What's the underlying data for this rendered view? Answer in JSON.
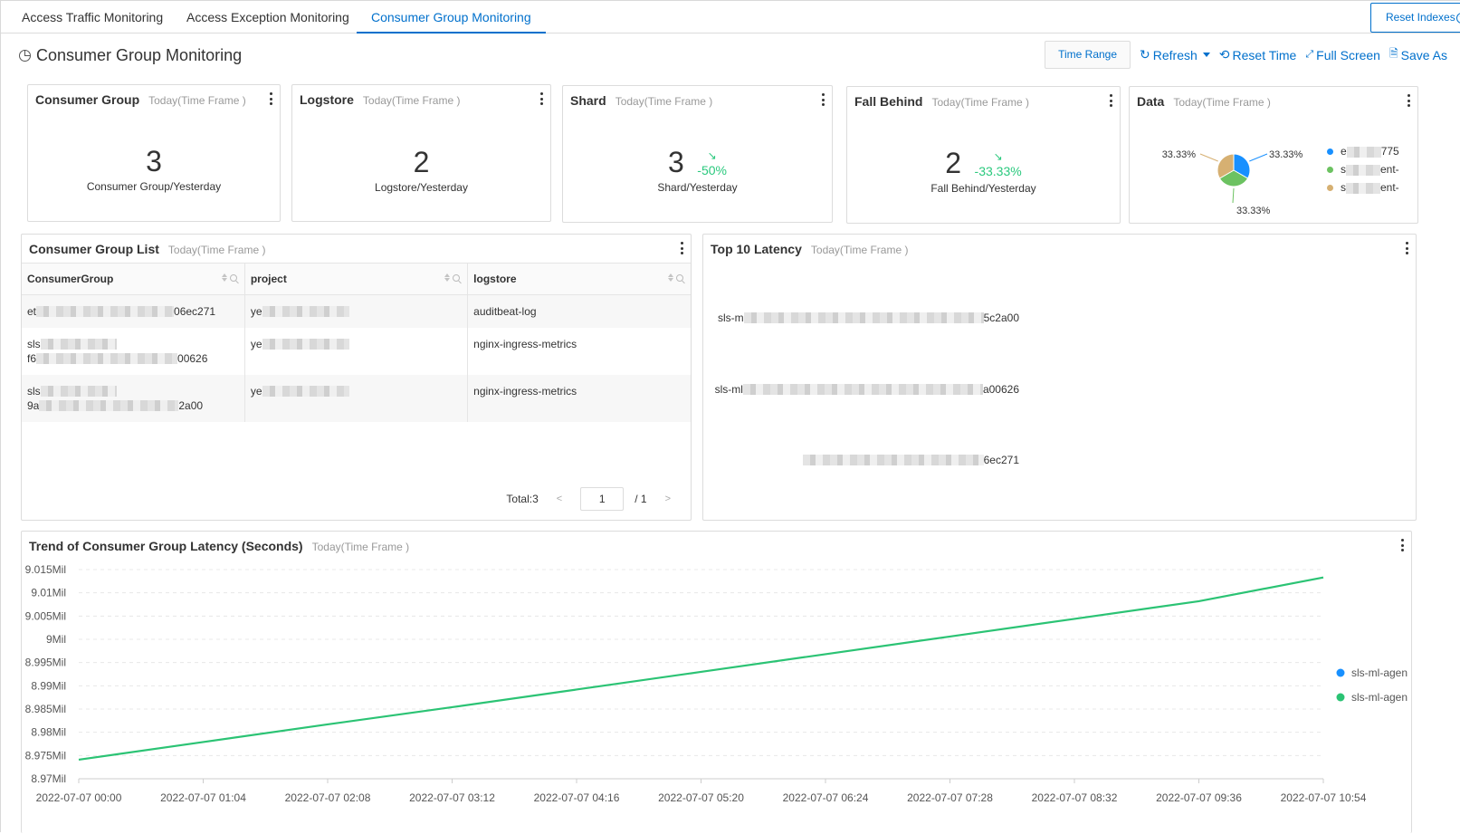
{
  "tabs": [
    {
      "label": "Access Traffic Monitoring",
      "active": false
    },
    {
      "label": "Access Exception Monitoring",
      "active": false
    },
    {
      "label": "Consumer Group Monitoring",
      "active": true
    }
  ],
  "reset_indexes_label": "Reset Indexes",
  "help_glyph": "?",
  "page_title": "Consumer Group Monitoring",
  "toolbar": {
    "time_range": "Time Range",
    "refresh": "Refresh",
    "reset_time": "Reset Time",
    "full_screen": "Full Screen",
    "save_as": "Save As"
  },
  "time_frame": "Today(Time Frame )",
  "stat_cards": [
    {
      "title": "Consumer Group",
      "value": "3",
      "compare_label": "Consumer Group/Yesterday",
      "delta": null
    },
    {
      "title": "Logstore",
      "value": "2",
      "compare_label": "Logstore/Yesterday",
      "delta": null
    },
    {
      "title": "Shard",
      "value": "3",
      "compare_label": "Shard/Yesterday",
      "delta": "-50%",
      "delta_color": "#2bc97e"
    },
    {
      "title": "Fall Behind",
      "value": "2",
      "compare_label": "Fall Behind/Yesterday",
      "delta": "-33.33%",
      "delta_color": "#2bc97e"
    }
  ],
  "data_card": {
    "title": "Data",
    "slices": [
      {
        "label": "33.33%",
        "value": 33.33,
        "color": "#1890ff",
        "legend_prefix": "e",
        "legend_suffix": "775"
      },
      {
        "label": "33.33%",
        "value": 33.33,
        "color": "#6cc261",
        "legend_prefix": "s",
        "legend_suffix": "ent-"
      },
      {
        "label": "33.33%",
        "value": 33.33,
        "color": "#d6b072",
        "legend_prefix": "s",
        "legend_suffix": "ent-"
      }
    ]
  },
  "consumer_list": {
    "title": "Consumer Group List",
    "columns": [
      "ConsumerGroup",
      "project",
      "logstore"
    ],
    "rows": [
      {
        "group_line1_prefix": "et",
        "group_line1_suffix": "06ec271",
        "group_line2_prefix": "",
        "group_line2_suffix": "",
        "project_prefix": "ye",
        "logstore": "auditbeat-log"
      },
      {
        "group_line1_prefix": "sls",
        "group_line1_suffix": "",
        "group_line2_prefix": "f6",
        "group_line2_suffix": "00626",
        "project_prefix": "ye",
        "logstore": "nginx-ingress-metrics"
      },
      {
        "group_line1_prefix": "sls",
        "group_line1_suffix": "",
        "group_line2_prefix": "9a",
        "group_line2_suffix": "2a00",
        "project_prefix": "ye",
        "logstore": "nginx-ingress-metrics"
      }
    ],
    "pager": {
      "total_label": "Total:3",
      "prev": "<",
      "page": "1",
      "of_label": "/ 1",
      "next": ">"
    }
  },
  "top10": {
    "title": "Top 10 Latency",
    "rows": [
      {
        "prefix": "sls-m",
        "suffix": "5c2a00"
      },
      {
        "prefix": "sls-ml",
        "suffix": "a00626"
      },
      {
        "prefix": "",
        "suffix": "6ec271"
      }
    ]
  },
  "chart_data": {
    "type": "line",
    "title": "Trend of Consumer Group Latency (Seconds)",
    "subtitle": "Today(Time Frame )",
    "xlabel": "",
    "ylabel": "",
    "x": [
      "2022-07-07 00:00",
      "2022-07-07 01:04",
      "2022-07-07 02:08",
      "2022-07-07 03:12",
      "2022-07-07 04:16",
      "2022-07-07 05:20",
      "2022-07-07 06:24",
      "2022-07-07 07:28",
      "2022-07-07 08:32",
      "2022-07-07 09:36",
      "2022-07-07 10:54"
    ],
    "x_ticks": [
      "2022-07-07 00:00",
      "2022-07-07 01:04",
      "2022-07-07 02:08",
      "2022-07-07 03:12",
      "2022-07-07 04:16",
      "2022-07-07 05:20",
      "2022-07-07 06:24",
      "2022-07-07 07:28",
      "2022-07-07 08:32",
      "2022-07-07 09:36",
      "2022-07-07 10:54"
    ],
    "y_ticks": [
      "8.97Mil",
      "8.975Mil",
      "8.98Mil",
      "8.985Mil",
      "8.99Mil",
      "8.995Mil",
      "9Mil",
      "9.005Mil",
      "9.01Mil",
      "9.015Mil"
    ],
    "ylim": [
      8970000,
      9015000
    ],
    "grid": true,
    "legend_position": "right",
    "series": [
      {
        "name": "sls-ml-agen",
        "color": "#1890ff",
        "values": [
          null,
          null,
          null,
          null,
          null,
          null,
          null,
          null,
          null,
          null,
          null
        ]
      },
      {
        "name": "sls-ml-agen",
        "color": "#2bc374",
        "values": [
          8974100,
          8977900,
          8981700,
          8985400,
          8989200,
          8993000,
          8996800,
          9000600,
          9004400,
          9008200,
          9013300
        ]
      }
    ]
  }
}
